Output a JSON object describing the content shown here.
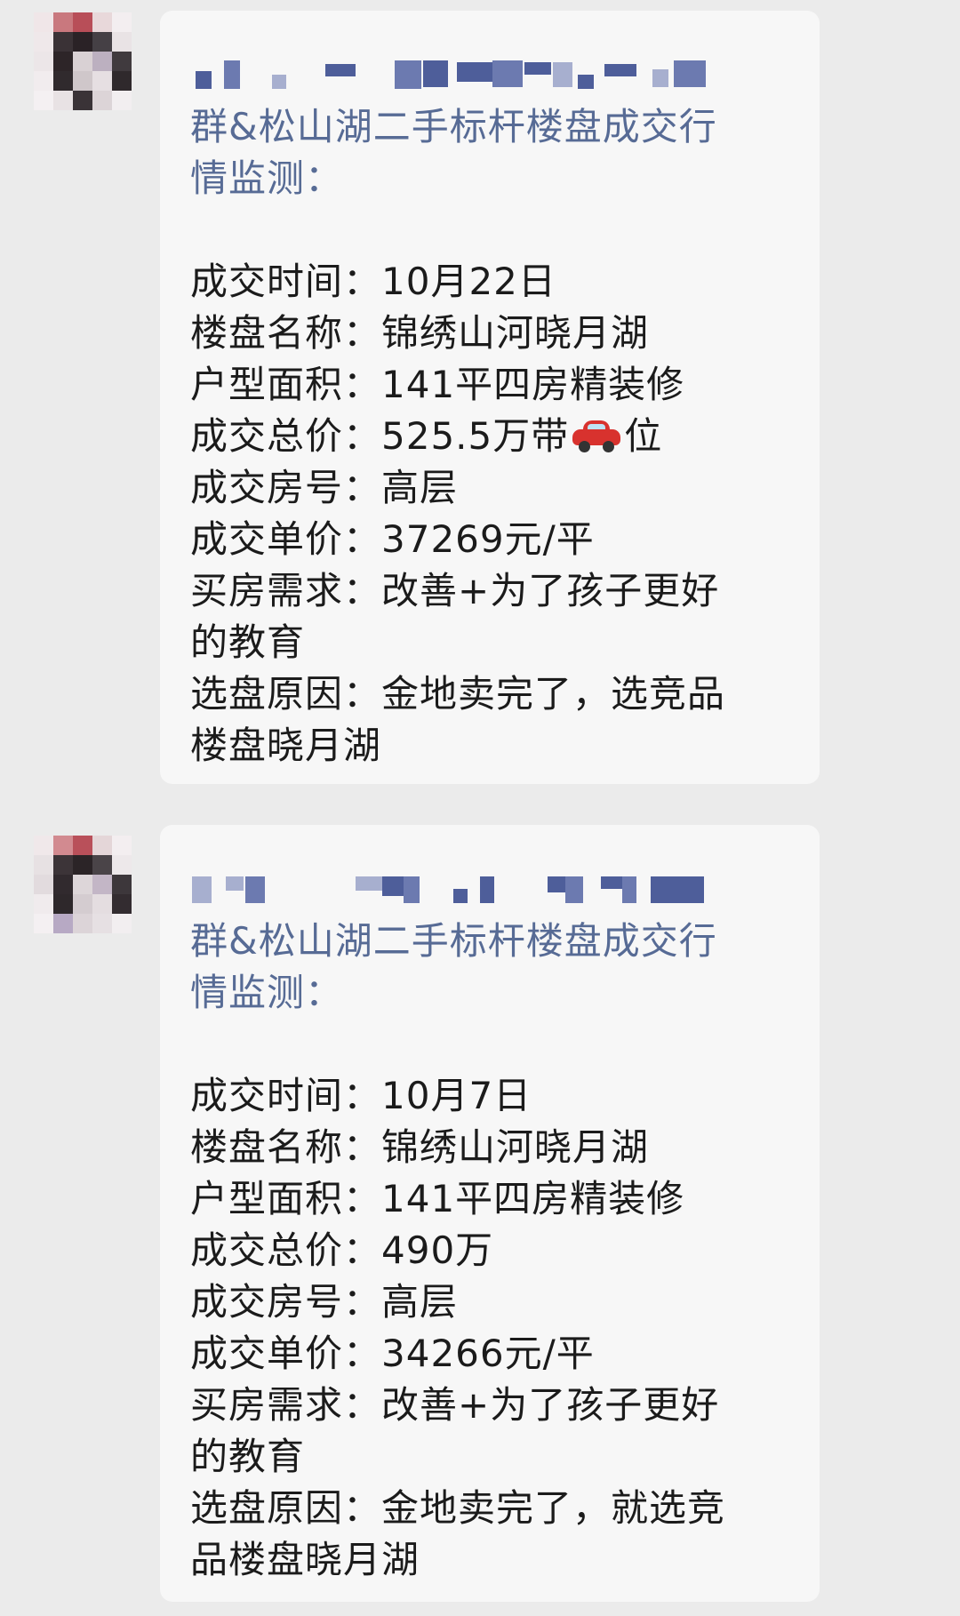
{
  "messages": [
    {
      "header_line1": "群&松山湖二手标杆楼盘成交行",
      "header_line2": "情监测：",
      "rows": [
        {
          "label": "成交时间：",
          "value": "10月22日"
        },
        {
          "label": "楼盘名称：",
          "value": "锦绣山河晓月湖"
        },
        {
          "label": "户型面积：",
          "value": "141平四房精装修"
        },
        {
          "label": "成交总价：",
          "value_before_icon": "525.5万带",
          "icon": "car-icon",
          "value_after_icon": "位"
        },
        {
          "label": "成交房号：",
          "value": "高层"
        },
        {
          "label": "成交单价：",
          "value": "37269元/平"
        },
        {
          "label": "买房需求：",
          "value": "改善+为了孩子更好",
          "continuation": "的教育"
        },
        {
          "label": "选盘原因：",
          "value": "金地卖完了，选竞品",
          "continuation": "楼盘晓月湖"
        }
      ]
    },
    {
      "header_line1": "群&松山湖二手标杆楼盘成交行",
      "header_line2": "情监测：",
      "rows": [
        {
          "label": "成交时间：",
          "value": "10月7日"
        },
        {
          "label": "楼盘名称：",
          "value": "锦绣山河晓月湖"
        },
        {
          "label": "户型面积：",
          "value": "141平四房精装修"
        },
        {
          "label": "成交总价：",
          "value": "490万"
        },
        {
          "label": "成交房号：",
          "value": "高层"
        },
        {
          "label": "成交单价：",
          "value": "34266元/平"
        },
        {
          "label": "买房需求：",
          "value": "改善+为了孩子更好",
          "continuation": "的教育"
        },
        {
          "label": "选盘原因：",
          "value": "金地卖完了，就选竞",
          "continuation": "品楼盘晓月湖"
        }
      ]
    }
  ],
  "colors": {
    "background": "#ebebeb",
    "bubble": "#f7f7f7",
    "header_text": "#576b95",
    "body_text": "#1b1b1b",
    "mosaic": "#4e5e9a"
  }
}
